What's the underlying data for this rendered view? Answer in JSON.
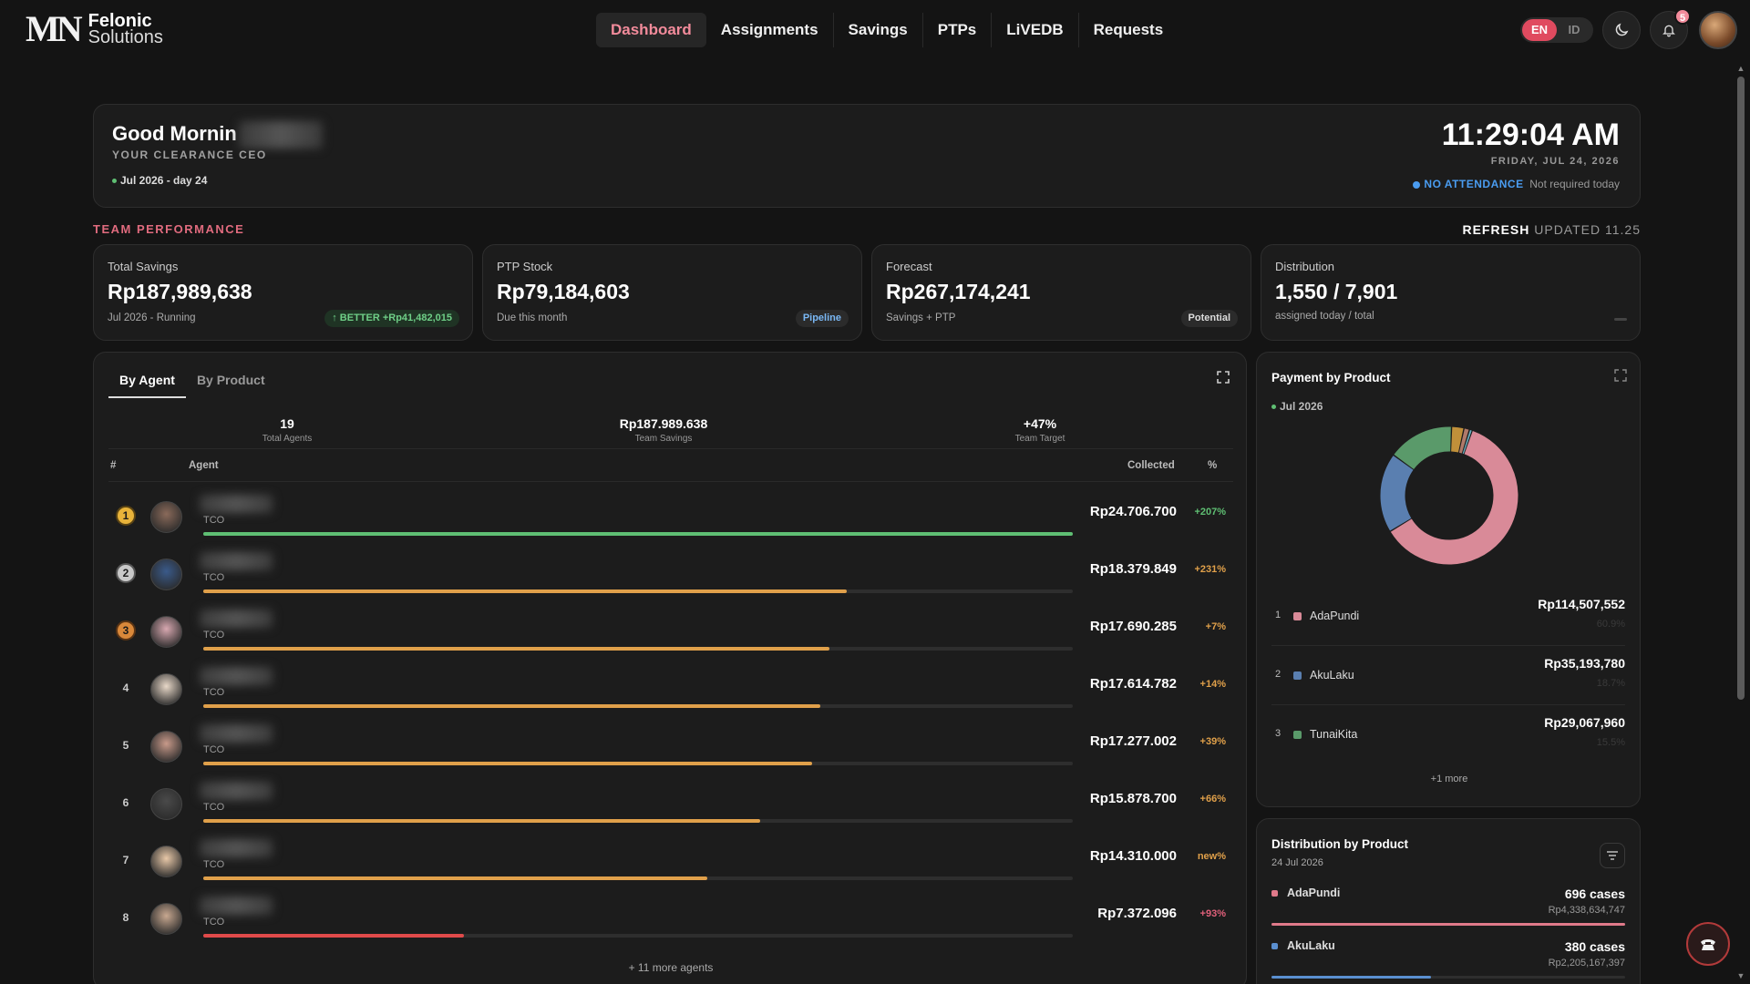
{
  "brand": {
    "mark": "MN",
    "line1": "Felonic",
    "line2": "Solutions"
  },
  "nav": {
    "items": [
      {
        "label": "Dashboard",
        "active": true
      },
      {
        "label": "Assignments"
      },
      {
        "label": "Savings"
      },
      {
        "label": "PTPs"
      },
      {
        "label": "LiVEDB"
      },
      {
        "label": "Requests"
      }
    ],
    "lang": {
      "en": "EN",
      "id": "ID",
      "selected": "EN"
    },
    "notifications": "5"
  },
  "greeting": {
    "title": "Good Mornin",
    "subtitle": "YOUR CLEARANCE CEO",
    "period": "Jul 2026 - day 24",
    "time": "11:29:04 AM",
    "date": "FRIDAY, JUL 24, 2026",
    "attendance": "NO ATTENDANCE",
    "attendance_note": "Not required today"
  },
  "team": {
    "title": "TEAM PERFORMANCE",
    "refresh": "REFRESH",
    "updated": "UPDATED 11.25"
  },
  "kpis": [
    {
      "label": "Total Savings",
      "value": "Rp187,989,638",
      "sub": "Jul 2026 - Running",
      "pill": "↑ BETTER +Rp41,482,015",
      "pill_style": "green"
    },
    {
      "label": "PTP Stock",
      "value": "Rp79,184,603",
      "sub": "Due this month",
      "pill": "Pipeline",
      "pill_style": "blue"
    },
    {
      "label": "Forecast",
      "value": "Rp267,174,241",
      "sub": "Savings + PTP",
      "pill": "Potential",
      "pill_style": "gray"
    },
    {
      "label": "Distribution",
      "value": "1,550 / 7,901",
      "sub": "assigned today / total"
    }
  ],
  "agents_panel": {
    "tabs": [
      "By Agent",
      "By Product"
    ],
    "stats": [
      {
        "value": "19",
        "label": "Total Agents"
      },
      {
        "value": "Rp187.989.638",
        "label": "Team Savings"
      },
      {
        "value": "+47%",
        "label": "Team Target"
      }
    ],
    "headers": {
      "rank": "#",
      "agent": "Agent",
      "collected": "Collected",
      "pct": "%"
    },
    "rows": [
      {
        "rank": "1",
        "role": "TCO",
        "amount": "Rp24.706.700",
        "pct": "+207%",
        "progress": 1.0,
        "color": "#5fbf73",
        "pct_color": "#5fbf73"
      },
      {
        "rank": "2",
        "role": "TCO",
        "amount": "Rp18.379.849",
        "pct": "+231%",
        "progress": 0.74,
        "color": "#e0a04a",
        "pct_color": "#e0a04a"
      },
      {
        "rank": "3",
        "role": "TCO",
        "amount": "Rp17.690.285",
        "pct": "+7%",
        "progress": 0.72,
        "color": "#e0a04a",
        "pct_color": "#e0a04a"
      },
      {
        "rank": "4",
        "role": "TCO",
        "amount": "Rp17.614.782",
        "pct": "+14%",
        "progress": 0.71,
        "color": "#e0a04a",
        "pct_color": "#e0a04a"
      },
      {
        "rank": "5",
        "role": "TCO",
        "amount": "Rp17.277.002",
        "pct": "+39%",
        "progress": 0.7,
        "color": "#e0a04a",
        "pct_color": "#e0a04a"
      },
      {
        "rank": "6",
        "role": "TCO",
        "amount": "Rp15.878.700",
        "pct": "+66%",
        "progress": 0.64,
        "color": "#e0a04a",
        "pct_color": "#e0a04a"
      },
      {
        "rank": "7",
        "role": "TCO",
        "amount": "Rp14.310.000",
        "pct": "new%",
        "progress": 0.58,
        "color": "#e0a04a",
        "pct_color": "#e0a04a"
      },
      {
        "rank": "8",
        "role": "TCO",
        "amount": "Rp7.372.096",
        "pct": "+93%",
        "progress": 0.3,
        "color": "#e04a4a",
        "pct_color": "#e0607a"
      }
    ],
    "more": "+ 11 more agents"
  },
  "payment": {
    "title": "Payment by Product",
    "month": "Jul 2026",
    "items": [
      {
        "rank": "1",
        "name": "AdaPundi",
        "amount": "Rp114,507,552",
        "pct": "60.9%",
        "value": 60.9,
        "color": "#d98a98"
      },
      {
        "rank": "2",
        "name": "AkuLaku",
        "amount": "Rp35,193,780",
        "pct": "18.7%",
        "value": 18.7,
        "color": "#5a7fb0"
      },
      {
        "rank": "3",
        "name": "TunaiKita",
        "amount": "Rp29,067,960",
        "pct": "15.5%",
        "value": 15.5,
        "color": "#5a9a6a"
      }
    ],
    "other_segments": [
      {
        "value": 2.9,
        "color": "#c0903a"
      },
      {
        "value": 1.3,
        "color": "#b07a6a"
      },
      {
        "value": 0.7,
        "color": "#6ab0c0"
      }
    ],
    "more": "+1 more"
  },
  "distribution": {
    "title": "Distribution by Product",
    "date": "24 Jul 2026",
    "items": [
      {
        "name": "AdaPundi",
        "cases": "696 cases",
        "amount": "Rp4,338,634,747",
        "share": 1.0,
        "color": "#e07a8a"
      },
      {
        "name": "AkuLaku",
        "cases": "380 cases",
        "amount": "Rp2,205,167,397",
        "share": 0.45,
        "color": "#5a8fd0"
      }
    ]
  }
}
